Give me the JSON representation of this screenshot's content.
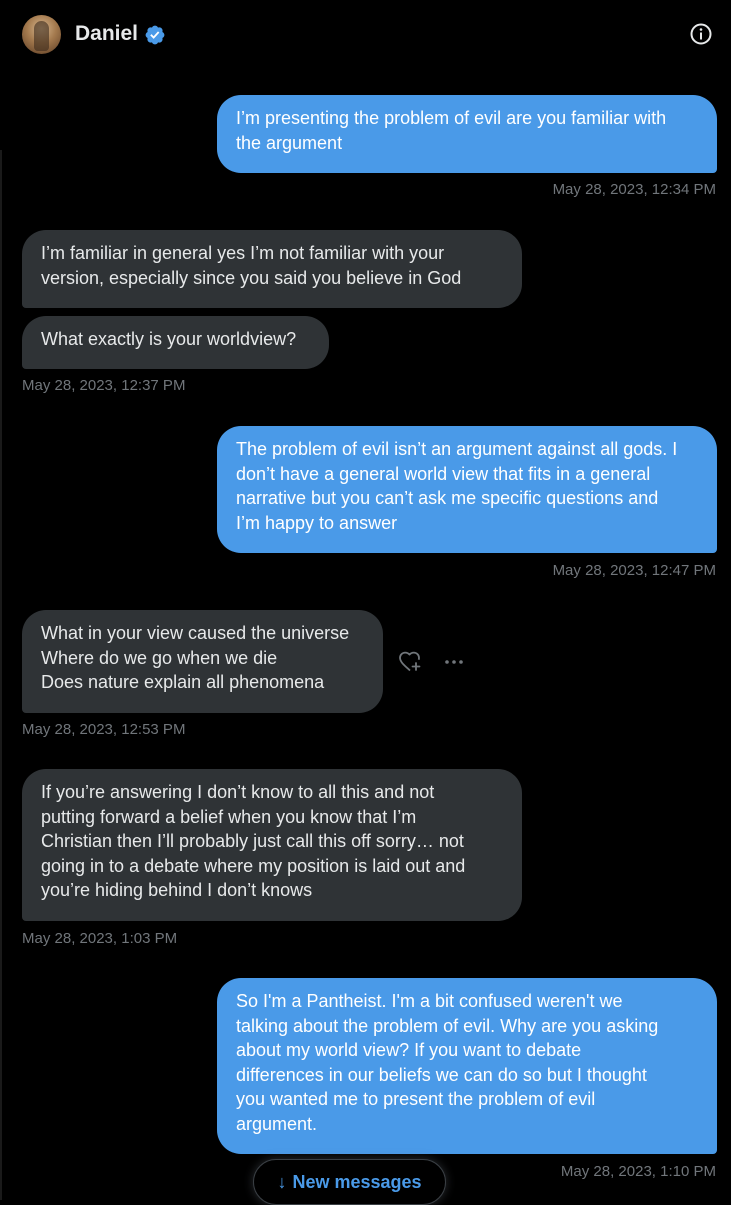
{
  "header": {
    "contact_name": "Daniel",
    "avatar_icon": "avatar",
    "verified_icon": "verified-badge-icon",
    "info_icon": "info-icon",
    "accent_color": "#4a9ae8"
  },
  "messages": [
    {
      "direction": "sent",
      "text": "I’m presenting the problem of evil are you familiar with\nthe argument",
      "timestamp": "May 28, 2023, 12:34 PM"
    },
    {
      "direction": "received",
      "text": "I’m familiar in general yes I’m not familiar with your\nversion, especially since you said you believe in God"
    },
    {
      "direction": "received",
      "text": "What exactly is your worldview?",
      "timestamp": "May 28, 2023, 12:37 PM"
    },
    {
      "direction": "sent",
      "text": "The problem of evil isn’t an argument against all gods. I\ndon’t have a general world view that fits in a general\nnarrative but you can’t ask me specific questions and\nI’m happy to answer",
      "timestamp": "May 28, 2023, 12:47 PM"
    },
    {
      "direction": "received",
      "text": "What in your view caused the universe\nWhere do we go when we die\nDoes nature explain all phenomena",
      "timestamp": "May 28, 2023, 12:53 PM",
      "actions": [
        "heart-plus-icon",
        "more-icon"
      ]
    },
    {
      "direction": "received",
      "text": "If you’re answering I don’t know to all this and not\nputting forward a belief when you know that I’m\nChristian then I’ll probably just call this off sorry… not\ngoing in to a debate where my position is laid out and\nyou’re hiding behind I don’t knows",
      "timestamp": "May 28, 2023, 1:03 PM"
    },
    {
      "direction": "sent",
      "text": "So I'm a Pantheist. I'm a bit confused weren't we\ntalking about the problem of evil. Why are you asking\nabout my world view? If you want to debate\ndifferences in our beliefs we can do so but I thought\nyou wanted me to present the problem of evil\nargument.",
      "timestamp": "May 28, 2023, 1:10 PM"
    }
  ],
  "new_messages_button": {
    "arrow": "↓",
    "label": "New messages"
  }
}
